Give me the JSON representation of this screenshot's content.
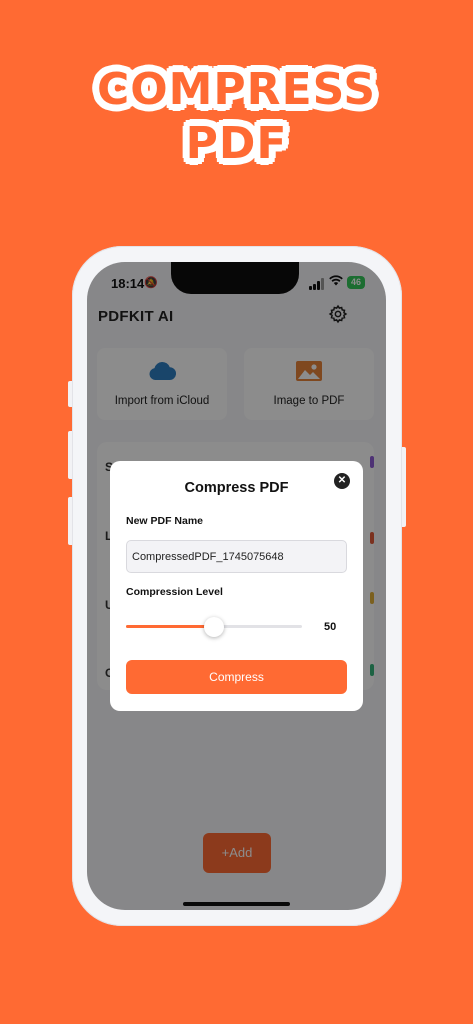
{
  "headline": {
    "line1": "COMPRESS",
    "line2": "PDF"
  },
  "status_bar": {
    "time": "18:14",
    "battery": "46"
  },
  "app": {
    "title": "PDFKIT AI"
  },
  "cards": [
    {
      "label": "Import from iCloud",
      "icon": "cloud-icon"
    },
    {
      "label": "Image to PDF",
      "icon": "image-icon"
    }
  ],
  "list_rows": [
    {
      "letter": "S",
      "accent": "#8e5bd6"
    },
    {
      "letter": "L",
      "accent": "#e05a3a"
    },
    {
      "letter": "U",
      "accent": "#e0b03a"
    },
    {
      "letter": "C",
      "accent": "#34b37a"
    }
  ],
  "add_button": {
    "label": "Add"
  },
  "modal": {
    "title": "Compress PDF",
    "name_label": "New PDF Name",
    "name_value": "CompressedPDF_1745075648",
    "level_label": "Compression Level",
    "level": 50,
    "level_text": "50",
    "compress_label": "Compress"
  },
  "colors": {
    "accent": "#FF6A33",
    "cloud": "#2f7ec2",
    "image": "#e8833a"
  }
}
